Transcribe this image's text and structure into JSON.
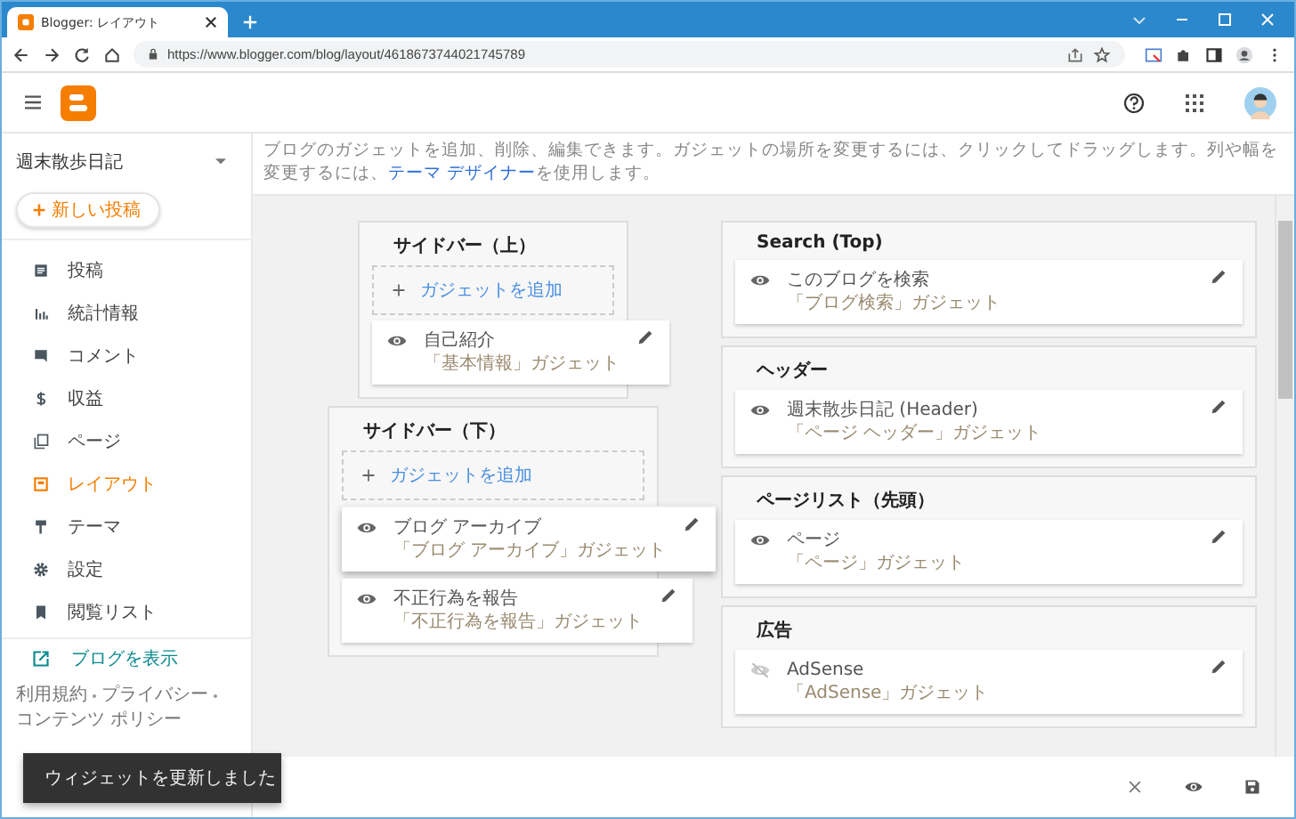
{
  "browser": {
    "tab_title": "Blogger: レイアウト",
    "url": "https://www.blogger.com/blog/layout/4618673744021745789"
  },
  "sidebar": {
    "blog_name": "週末散歩日記",
    "new_post": "新しい投稿",
    "items": [
      {
        "label": "投稿",
        "selected": false
      },
      {
        "label": "統計情報",
        "selected": false
      },
      {
        "label": "コメント",
        "selected": false
      },
      {
        "label": "収益",
        "selected": false
      },
      {
        "label": "ページ",
        "selected": false
      },
      {
        "label": "レイアウト",
        "selected": true
      },
      {
        "label": "テーマ",
        "selected": false
      },
      {
        "label": "設定",
        "selected": false
      },
      {
        "label": "閲覧リスト",
        "selected": false
      }
    ],
    "view_blog": "ブログを表示",
    "footer_links": [
      "利用規約",
      "プライバシー",
      "コンテンツ ポリシー"
    ]
  },
  "description": {
    "text": "ブログのガジェットを追加、削除、編集できます。ガジェットの場所を変更するには、クリックしてドラッグします。列や幅を変更するには、",
    "link": "テーマ デザイナー",
    "after": "を使用します。"
  },
  "columns": [
    {
      "sections": [
        {
          "title": "サイドバー（上）",
          "add_label": "ガジェットを追加",
          "gadgets": [
            {
              "name": "自己紹介",
              "type": "「基本情報」ガジェット",
              "visible": true,
              "dragging": false
            }
          ]
        },
        {
          "title": "サイドバー（下）",
          "add_label": "ガジェットを追加",
          "gadgets": [
            {
              "name": "ブログ アーカイブ",
              "type": "「ブログ アーカイブ」ガジェット",
              "visible": true,
              "dragging": true
            },
            {
              "name": "不正行為を報告",
              "type": "「不正行為を報告」ガジェット",
              "visible": true,
              "dragging": false
            }
          ]
        }
      ]
    },
    {
      "sections": [
        {
          "title": "Search (Top)",
          "gadgets": [
            {
              "name": "このブログを検索",
              "type": "「ブログ検索」ガジェット",
              "visible": true,
              "dragging": false
            }
          ]
        },
        {
          "title": "ヘッダー",
          "gadgets": [
            {
              "name": "週末散歩日記 (Header)",
              "type": "「ページ ヘッダー」ガジェット",
              "visible": true,
              "dragging": false
            }
          ]
        },
        {
          "title": "ページリスト（先頭）",
          "gadgets": [
            {
              "name": "ページ",
              "type": "「ページ」ガジェット",
              "visible": true,
              "dragging": false
            }
          ]
        },
        {
          "title": "広告",
          "gadgets": [
            {
              "name": "AdSense",
              "type": "「AdSense」ガジェット",
              "visible": false,
              "dragging": false
            }
          ]
        }
      ]
    }
  ],
  "toast": "ウィジェットを更新しました"
}
